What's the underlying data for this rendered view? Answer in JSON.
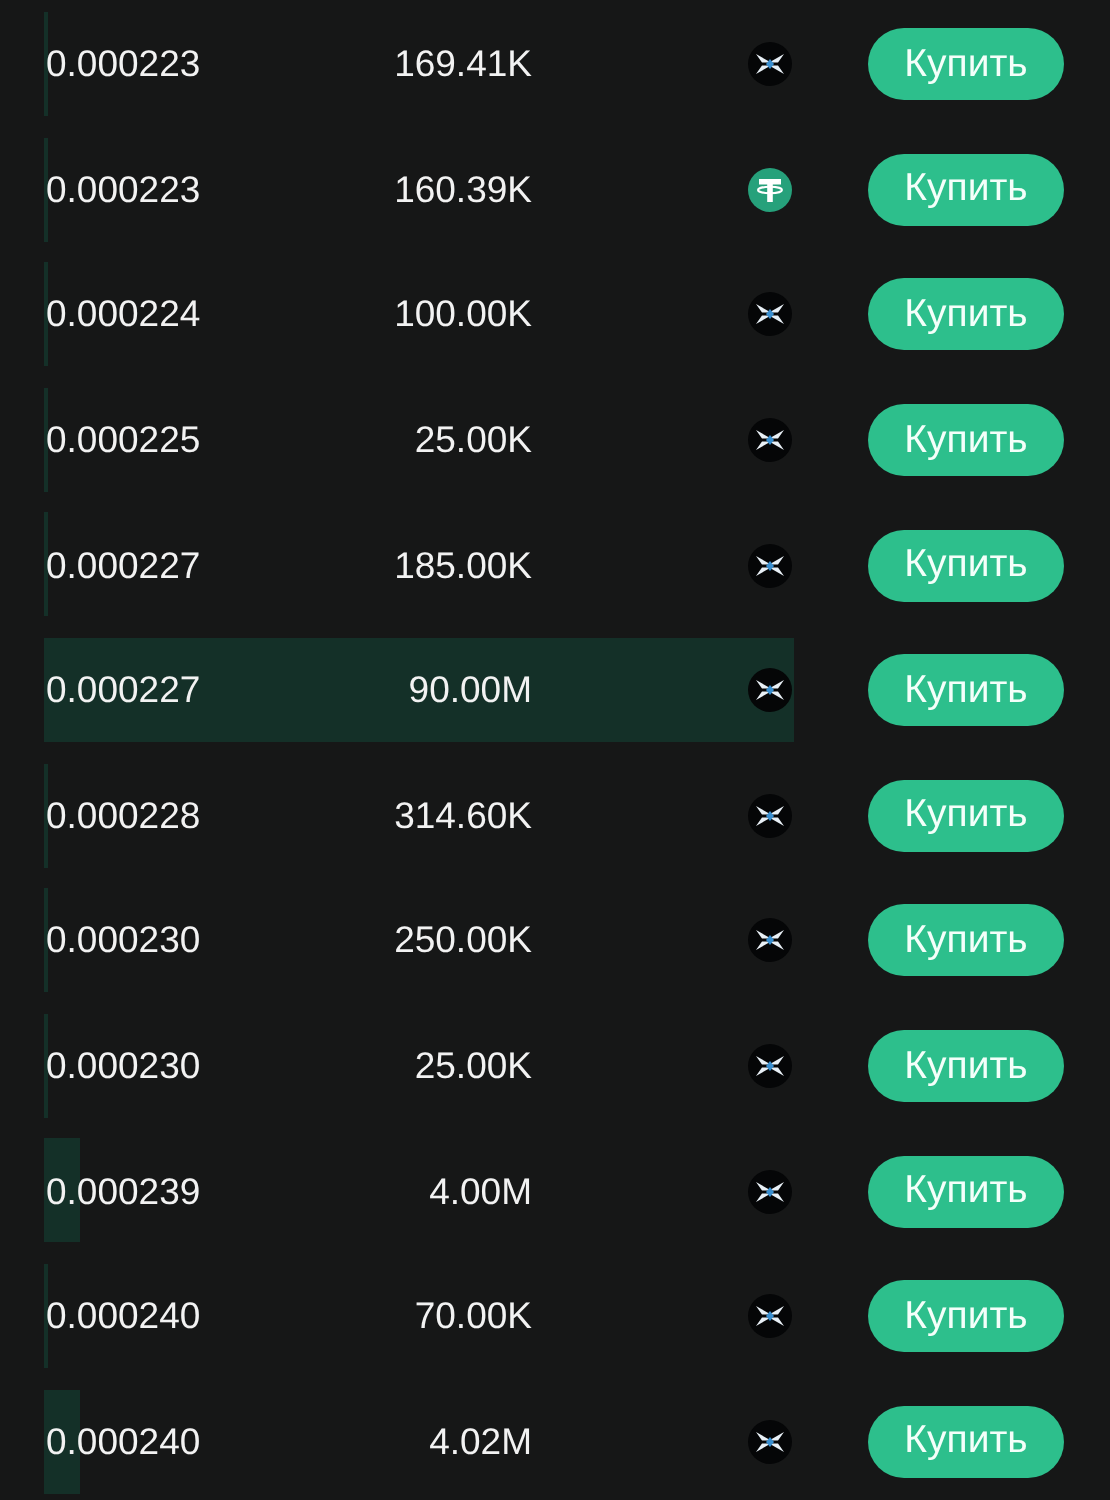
{
  "orders": [
    {
      "price": "0.000223",
      "amount": "169.41K",
      "kind": "x-coin",
      "depth": {
        "kind": "thin"
      },
      "action": "Купить"
    },
    {
      "price": "0.000223",
      "amount": "160.39K",
      "kind": "tether",
      "depth": {
        "kind": "thin"
      },
      "action": "Купить"
    },
    {
      "price": "0.000224",
      "amount": "100.00K",
      "kind": "x-coin",
      "depth": {
        "kind": "thin"
      },
      "action": "Купить"
    },
    {
      "price": "0.000225",
      "amount": "25.00K",
      "kind": "x-coin",
      "depth": {
        "kind": "thin"
      },
      "action": "Купить"
    },
    {
      "price": "0.000227",
      "amount": "185.00K",
      "kind": "x-coin",
      "depth": {
        "kind": "thin"
      },
      "action": "Купить"
    },
    {
      "price": "0.000227",
      "amount": "90.00M",
      "kind": "x-coin",
      "depth": {
        "kind": "full"
      },
      "action": "Купить"
    },
    {
      "price": "0.000228",
      "amount": "314.60K",
      "kind": "x-coin",
      "depth": {
        "kind": "thin"
      },
      "action": "Купить"
    },
    {
      "price": "0.000230",
      "amount": "250.00K",
      "kind": "x-coin",
      "depth": {
        "kind": "thin"
      },
      "action": "Купить"
    },
    {
      "price": "0.000230",
      "amount": "25.00K",
      "kind": "x-coin",
      "depth": {
        "kind": "thin"
      },
      "action": "Купить"
    },
    {
      "price": "0.000239",
      "amount": "4.00M",
      "kind": "x-coin",
      "depth": {
        "kind": "short"
      },
      "action": "Купить"
    },
    {
      "price": "0.000240",
      "amount": "70.00K",
      "kind": "x-coin",
      "depth": {
        "kind": "thin"
      },
      "action": "Купить"
    },
    {
      "price": "0.000240",
      "amount": "4.02M",
      "kind": "x-coin",
      "depth": {
        "kind": "short"
      },
      "action": "Купить"
    }
  ]
}
